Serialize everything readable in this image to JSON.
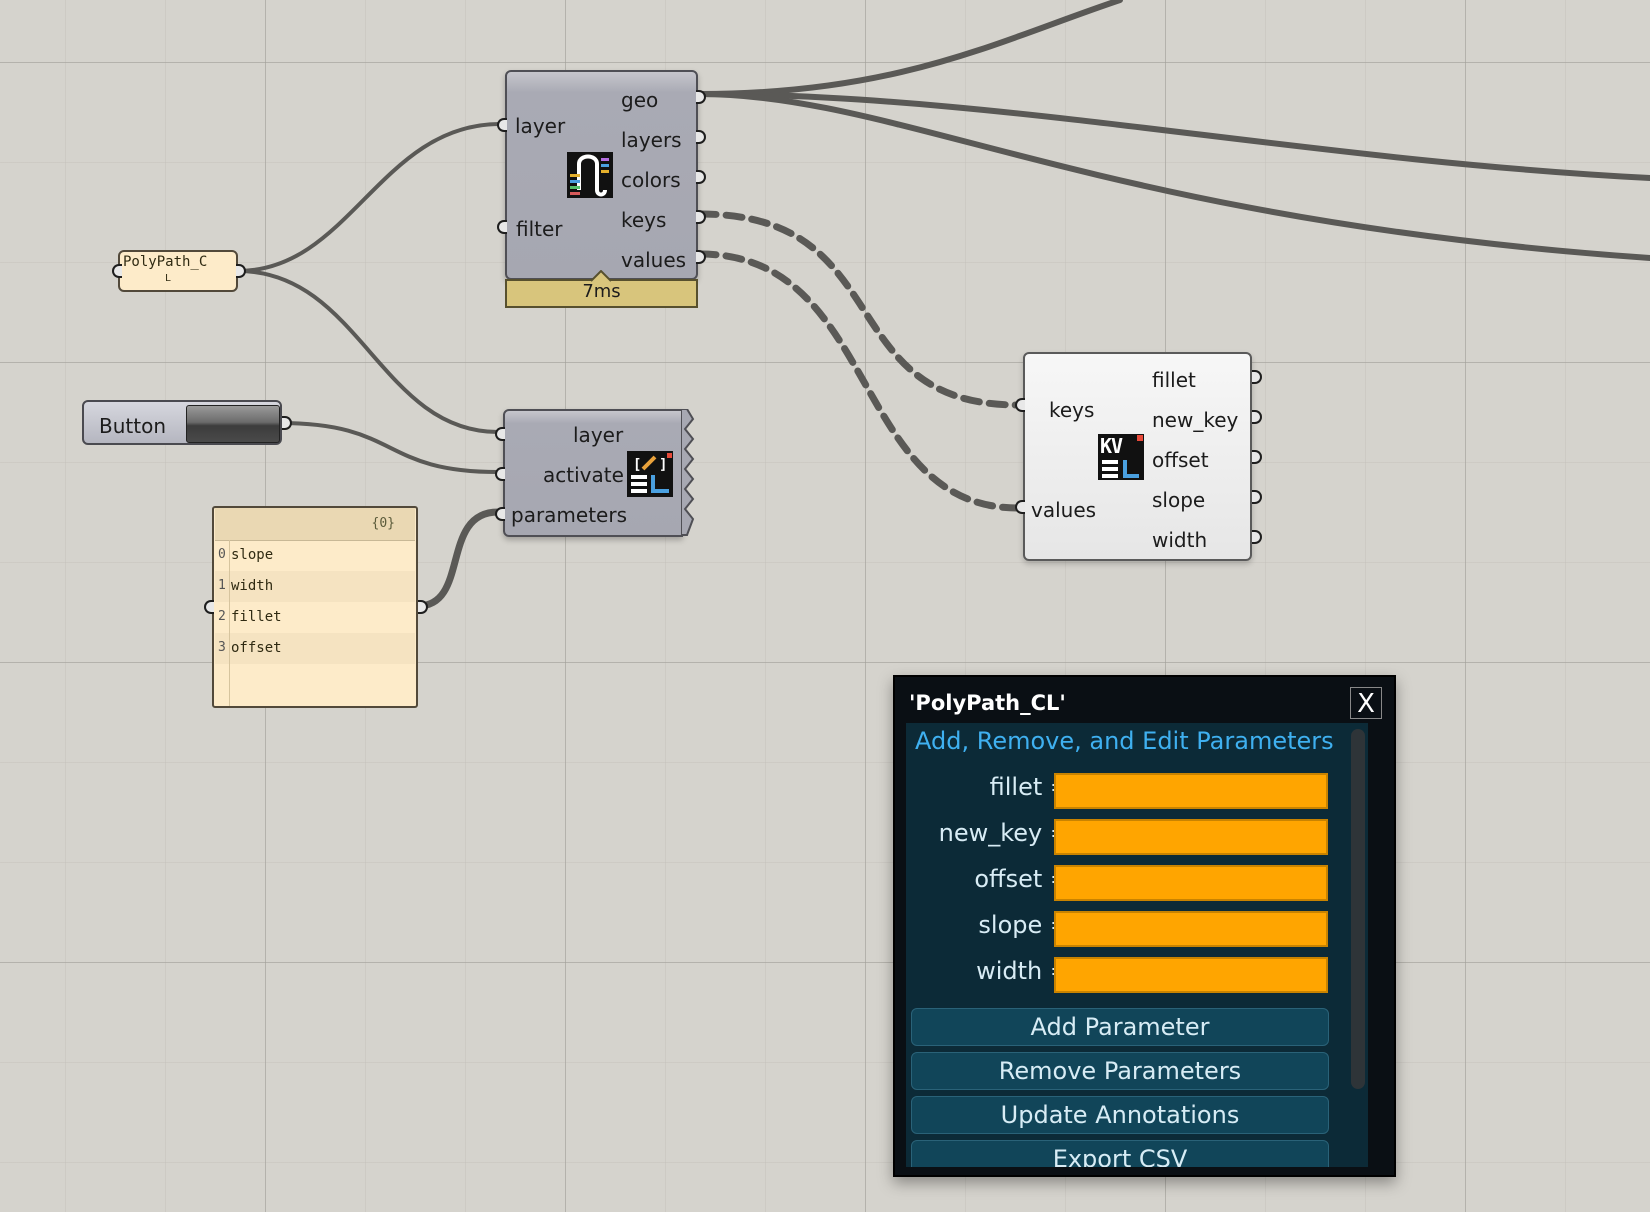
{
  "canvas": {
    "background_color": "#d5d3cd"
  },
  "polypath_param": {
    "label": "PolyPath_C",
    "sub": "L"
  },
  "reader_component": {
    "inputs": [
      "layer",
      "filter"
    ],
    "outputs": [
      "geo",
      "layers",
      "colors",
      "keys",
      "values"
    ],
    "timer": "7ms",
    "icon": "layer-reader-icon"
  },
  "button_component": {
    "label": "Button"
  },
  "panel": {
    "header": "{0}",
    "rows": [
      {
        "index": "0",
        "value": "slope"
      },
      {
        "index": "1",
        "value": "width"
      },
      {
        "index": "2",
        "value": "fillet"
      },
      {
        "index": "3",
        "value": "offset"
      }
    ]
  },
  "editor_component": {
    "inputs": [
      "layer",
      "activate",
      "parameters"
    ],
    "icon": "parameter-editor-icon"
  },
  "kv_component": {
    "inputs": [
      "keys",
      "values"
    ],
    "outputs": [
      "fillet",
      "new_key",
      "offset",
      "slope",
      "width"
    ],
    "icon": "kv-icon",
    "icon_text": "KV"
  },
  "popup": {
    "title": "'PolyPath_CL'",
    "close_label": "X",
    "subtitle": "Add, Remove, and Edit Parameters",
    "fields": [
      {
        "label": "fillet =",
        "value": ""
      },
      {
        "label": "new_key =",
        "value": ""
      },
      {
        "label": "offset =",
        "value": ""
      },
      {
        "label": "slope =",
        "value": ""
      },
      {
        "label": "width =",
        "value": ""
      }
    ],
    "buttons": [
      "Add Parameter",
      "Remove Parameters",
      "Update Annotations",
      "Export CSV"
    ],
    "field_color": "#ffa500",
    "accent_color": "#3fb0f0"
  }
}
